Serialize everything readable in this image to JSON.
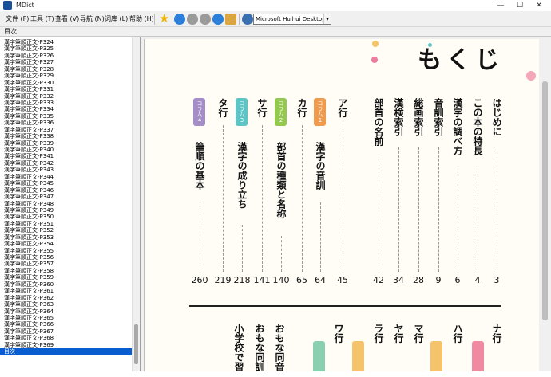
{
  "window": {
    "title": "MDict",
    "minimize": "—",
    "maximize": "☐",
    "close": "✕"
  },
  "menu": [
    "文件 (F)",
    "工具 (T)",
    "查看 (V)",
    "导航 (N)",
    "词库 (L)",
    "帮助 (H)"
  ],
  "toolbar": {
    "dictionary_select": "Microsoft Huihui Desktop - C",
    "icons": [
      "star-icon",
      "home-icon",
      "back-icon",
      "forward-icon",
      "previous-icon",
      "next-icon",
      "clipboard-icon",
      "speaker-icon"
    ]
  },
  "panel_header": "目次",
  "sidebar": {
    "items": [
      "漢字筆順正文-P324",
      "漢字筆順正文-P325",
      "漢字筆順正文-P326",
      "漢字筆順正文-P327",
      "漢字筆順正文-P328",
      "漢字筆順正文-P329",
      "漢字筆順正文-P330",
      "漢字筆順正文-P331",
      "漢字筆順正文-P332",
      "漢字筆順正文-P333",
      "漢字筆順正文-P334",
      "漢字筆順正文-P335",
      "漢字筆順正文-P336",
      "漢字筆順正文-P337",
      "漢字筆順正文-P338",
      "漢字筆順正文-P339",
      "漢字筆順正文-P340",
      "漢字筆順正文-P341",
      "漢字筆順正文-P342",
      "漢字筆順正文-P343",
      "漢字筆順正文-P344",
      "漢字筆順正文-P345",
      "漢字筆順正文-P346",
      "漢字筆順正文-P347",
      "漢字筆順正文-P348",
      "漢字筆順正文-P349",
      "漢字筆順正文-P350",
      "漢字筆順正文-P351",
      "漢字筆順正文-P352",
      "漢字筆順正文-P353",
      "漢字筆順正文-P354",
      "漢字筆順正文-P355",
      "漢字筆順正文-P356",
      "漢字筆順正文-P357",
      "漢字筆順正文-P358",
      "漢字筆順正文-P359",
      "漢字筆順正文-P360",
      "漢字筆順正文-P361",
      "漢字筆順正文-P362",
      "漢字筆順正文-P363",
      "漢字筆順正文-P364",
      "漢字筆順正文-P365",
      "漢字筆順正文-P366",
      "漢字筆順正文-P367",
      "漢字筆順正文-P368",
      "漢字筆順正文-P369",
      "目次"
    ],
    "selected": "目次"
  },
  "page": {
    "title": "もくじ",
    "upper_columns": [
      {
        "text": "はじめに",
        "page": "3"
      },
      {
        "text": "この本の特長",
        "page": "4"
      },
      {
        "text": "漢字の調べ方",
        "page": "6"
      },
      {
        "text": "音訓索引",
        "page": "9"
      },
      {
        "text": "総画索引",
        "page": "28"
      },
      {
        "text": "漢検索引",
        "page": "34"
      },
      {
        "text": "部首の名前",
        "page": "42"
      },
      {
        "text": "ア行",
        "page": "45"
      },
      {
        "badge": "コラム1",
        "text": "漢字の音訓",
        "page": "64",
        "color": "#ef9b4f"
      },
      {
        "text": "カ行",
        "page": "65"
      },
      {
        "badge": "コラム2",
        "text": "部首の種類と名称",
        "page": "140",
        "color": "#94c94f"
      },
      {
        "text": "サ行",
        "page": "141"
      },
      {
        "badge": "コラム3",
        "text": "漢字の成り立ち",
        "page": "218",
        "color": "#5ec4c6"
      },
      {
        "text": "タ行",
        "page": "219"
      },
      {
        "badge": "コラム4",
        "text": "筆順の基本",
        "page": "260",
        "color": "#a58ec8"
      }
    ],
    "lower_columns": [
      {
        "text": "ナ行"
      },
      {
        "text": "ハ行"
      },
      {
        "text": "マ行"
      },
      {
        "text": "ヤ行"
      },
      {
        "text": "ラ行"
      },
      {
        "text": "ワ行"
      },
      {
        "text": "おもな同音"
      },
      {
        "text": "おもな同訓"
      },
      {
        "text": "小学校で習"
      }
    ],
    "lower_badge_colors": [
      "#f08aa0",
      "#f5c46a",
      "#f5c46a",
      "#8ad0b0",
      "#f5c46a"
    ]
  }
}
